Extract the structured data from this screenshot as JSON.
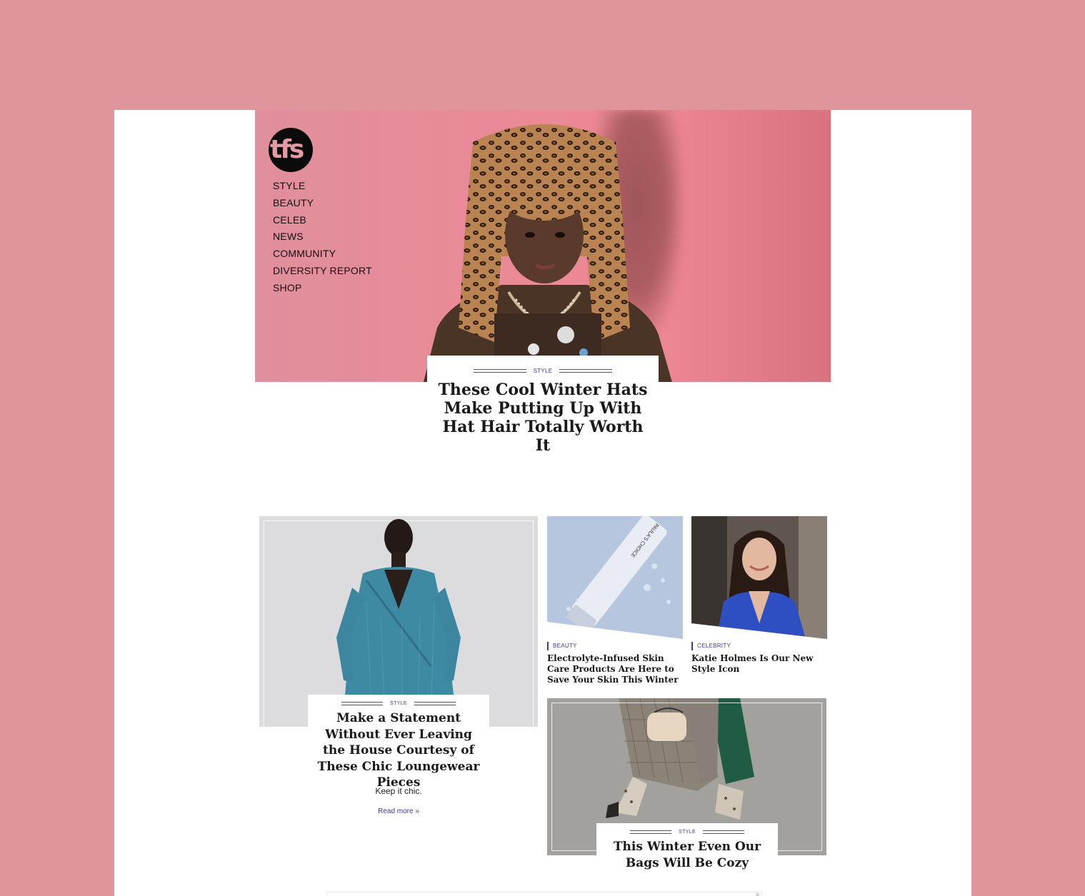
{
  "logo": {
    "text": "tfs"
  },
  "nav": {
    "items": [
      "STYLE",
      "BEAUTY",
      "CELEB",
      "NEWS",
      "COMMUNITY",
      "DIVERSITY REPORT",
      "SHOP"
    ]
  },
  "hero": {
    "category": "STYLE",
    "title": "These Cool Winter Hats Make Putting Up With Hat Hair Totally Worth It"
  },
  "feature_left": {
    "category": "STYLE",
    "title": "Make a Statement Without Ever Leaving the House Courtesy of These Chic Loungewear Pieces",
    "dek": "Keep it chic.",
    "read_more": "Read more »"
  },
  "small_cards": [
    {
      "category": "BEAUTY",
      "title": "Electrolyte-Infused Skin Care Products Are Here to Save Your Skin This Winter"
    },
    {
      "category": "CELEBRITY",
      "title": "Katie Holmes Is Our New Style Icon"
    }
  ],
  "feature_right": {
    "category": "STYLE",
    "title": "This Winter Even Our Bags Will Be Cozy"
  },
  "ad": {
    "close_icon": "close-icon"
  },
  "colors": {
    "background": "#e0959d",
    "accent": "#3b3b8f",
    "hero": "#ea8a98"
  }
}
